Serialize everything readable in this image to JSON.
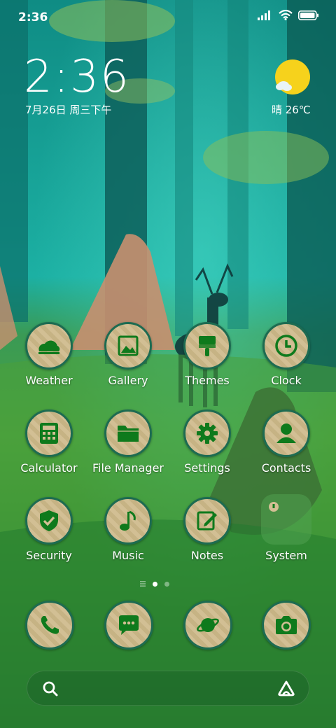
{
  "status_bar": {
    "time": "2:36",
    "icons": [
      "signal-icon",
      "wifi-icon",
      "battery-icon"
    ]
  },
  "clock_widget": {
    "time": "2:36",
    "date": "7月26日 周三下午"
  },
  "weather_widget": {
    "icon": "sun-cloud-icon",
    "text": "晴 26℃"
  },
  "apps": [
    {
      "label": "Weather",
      "icon": "weather-icon"
    },
    {
      "label": "Gallery",
      "icon": "gallery-icon"
    },
    {
      "label": "Themes",
      "icon": "themes-brush-icon"
    },
    {
      "label": "Clock",
      "icon": "clock-icon"
    },
    {
      "label": "Calculator",
      "icon": "calculator-icon"
    },
    {
      "label": "File Manager",
      "icon": "folder-icon"
    },
    {
      "label": "Settings",
      "icon": "gear-icon"
    },
    {
      "label": "Contacts",
      "icon": "person-icon"
    },
    {
      "label": "Security",
      "icon": "shield-check-icon"
    },
    {
      "label": "Music",
      "icon": "music-note-icon"
    },
    {
      "label": "Notes",
      "icon": "notes-pencil-icon"
    },
    {
      "label": "System",
      "icon": "system-folder-icon"
    }
  ],
  "dock": [
    {
      "icon": "phone-icon"
    },
    {
      "icon": "messages-icon"
    },
    {
      "icon": "browser-planet-icon"
    },
    {
      "icon": "camera-icon"
    }
  ],
  "page_indicator": {
    "pages": 2,
    "current": 1
  },
  "search": {
    "icon": "search-icon",
    "assistant_icon": "assistant-icon"
  },
  "colors": {
    "icon_glyph": "#0e7a1c",
    "icon_border": "#1d6b51",
    "sun": "#f6d21c"
  }
}
